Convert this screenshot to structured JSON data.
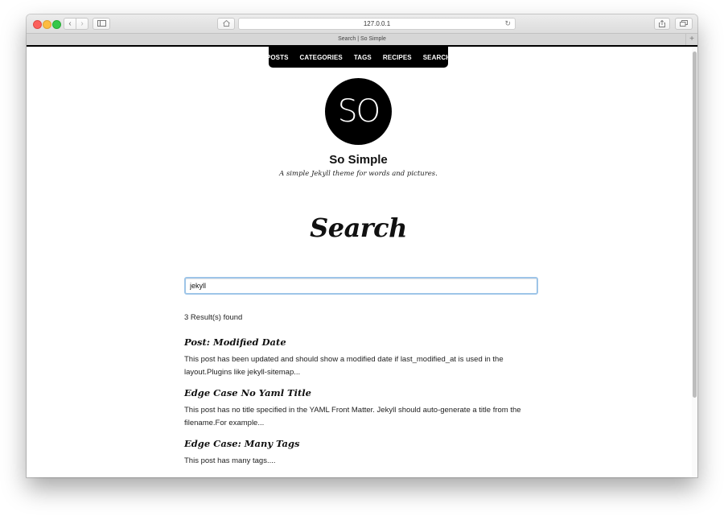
{
  "browser": {
    "url": "127.0.0.1",
    "tab_title": "Search | So Simple",
    "new_tab_label": "+"
  },
  "nav": {
    "items": [
      {
        "label": "POSTS"
      },
      {
        "label": "CATEGORIES"
      },
      {
        "label": "TAGS"
      },
      {
        "label": "RECIPES"
      },
      {
        "label": "SEARCH"
      }
    ]
  },
  "site": {
    "logo_text": "SO",
    "title": "So Simple",
    "description": "A simple Jekyll theme for words and pictures."
  },
  "page": {
    "title": "Search"
  },
  "search": {
    "value": "jekyll",
    "result_count": "3 Result(s) found"
  },
  "results": [
    {
      "title": "Post: Modified Date",
      "excerpt": "This post has been updated and should show a modified date if last_modified_at is used in the layout.Plugins like jekyll-sitemap..."
    },
    {
      "title": "Edge Case No Yaml Title",
      "excerpt": "This post has no title specified in the YAML Front Matter. Jekyll should auto-generate a title from the filename.For example..."
    },
    {
      "title": "Edge Case: Many Tags",
      "excerpt": "This post has many tags...."
    }
  ],
  "icons": {
    "back": "chevron-left-icon",
    "forward": "chevron-right-icon",
    "sidebar": "sidebar-icon",
    "home": "home-icon",
    "reload": "reload-icon",
    "share": "share-icon",
    "tabs": "tabs-icon"
  },
  "colors": {
    "nav_bg": "#000000",
    "input_focus": "#9ec5e8",
    "text": "#111111"
  }
}
